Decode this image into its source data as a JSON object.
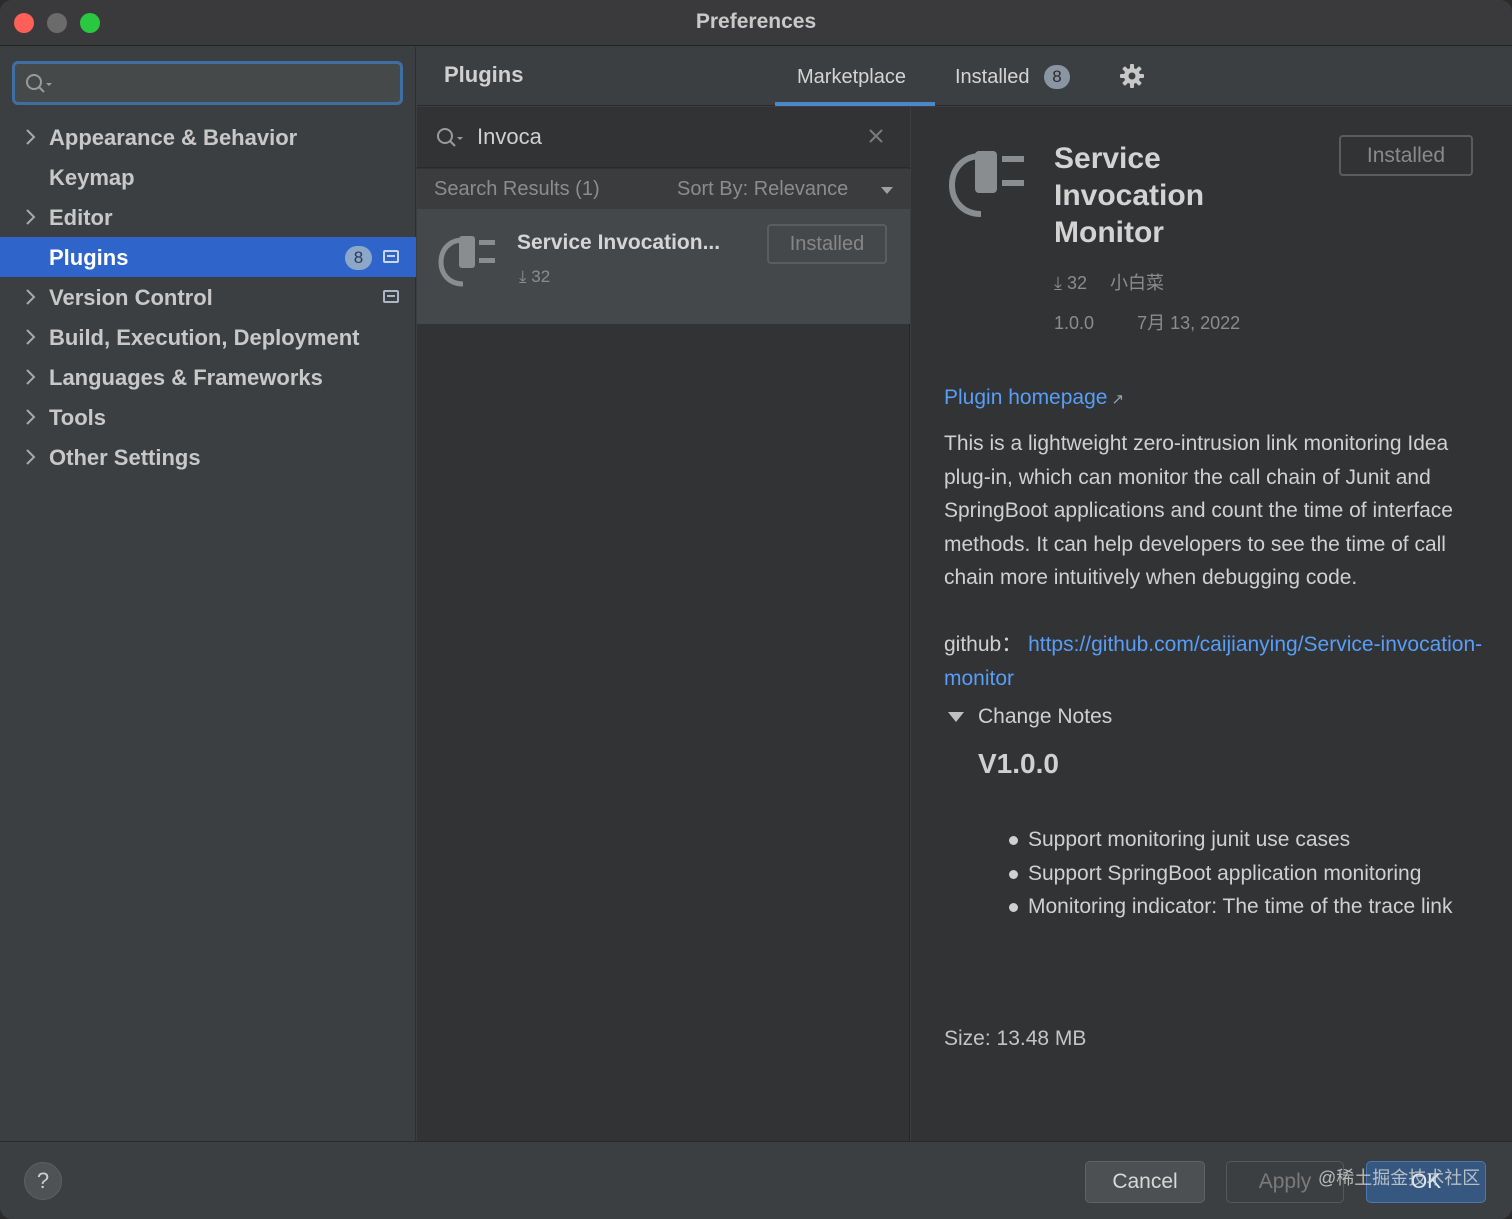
{
  "window": {
    "title": "Preferences"
  },
  "sidebar": {
    "search_value": "",
    "items": [
      {
        "label": "Appearance & Behavior",
        "expandable": true
      },
      {
        "label": "Keymap",
        "expandable": false
      },
      {
        "label": "Editor",
        "expandable": true
      },
      {
        "label": "Plugins",
        "expandable": false,
        "active": true,
        "badge": "8"
      },
      {
        "label": "Version Control",
        "expandable": true
      },
      {
        "label": "Build, Execution, Deployment",
        "expandable": true
      },
      {
        "label": "Languages & Frameworks",
        "expandable": true
      },
      {
        "label": "Tools",
        "expandable": true
      },
      {
        "label": "Other Settings",
        "expandable": true
      }
    ]
  },
  "header": {
    "title": "Plugins",
    "tabs": [
      {
        "label": "Marketplace",
        "selected": true
      },
      {
        "label": "Installed",
        "badge": "8",
        "selected": false
      }
    ],
    "settings_icon": "gear-icon"
  },
  "search": {
    "query": "Invoca",
    "results_label": "Search Results (1)",
    "sort_label": "Sort By: Relevance"
  },
  "results": [
    {
      "name": "Service Invocation...",
      "downloads": "32",
      "status": "Installed"
    }
  ],
  "detail": {
    "name": "Service Invocation Monitor",
    "status": "Installed",
    "downloads": "32",
    "vendor": "小白菜",
    "version": "1.0.0",
    "date": "7月 13, 2022",
    "homepage_label": "Plugin homepage",
    "description": "This is a lightweight zero-intrusion link monitoring Idea plug-in, which can monitor the call chain of Junit and SpringBoot applications and count the time of interface methods. It can help developers to see the time of call chain more intuitively when debugging code.",
    "github_label": "github：",
    "github_url": "https://github.com/caijianying/Service-invocation-monitor",
    "change_notes_label": "Change Notes",
    "change_version": "V1.0.0",
    "change_items": [
      "Support monitoring junit use cases",
      "Support SpringBoot application monitoring",
      "Monitoring indicator: The time of the trace link"
    ],
    "size": "Size: 13.48 MB"
  },
  "footer": {
    "help_label": "?",
    "cancel_label": "Cancel",
    "apply_label": "Apply",
    "ok_label": "OK",
    "watermark": "@稀土掘金技术社区"
  },
  "colors": {
    "accent": "#2f65ca",
    "link": "#589df6",
    "window_bg": "#3c3f41",
    "panel_bg": "#313335"
  }
}
